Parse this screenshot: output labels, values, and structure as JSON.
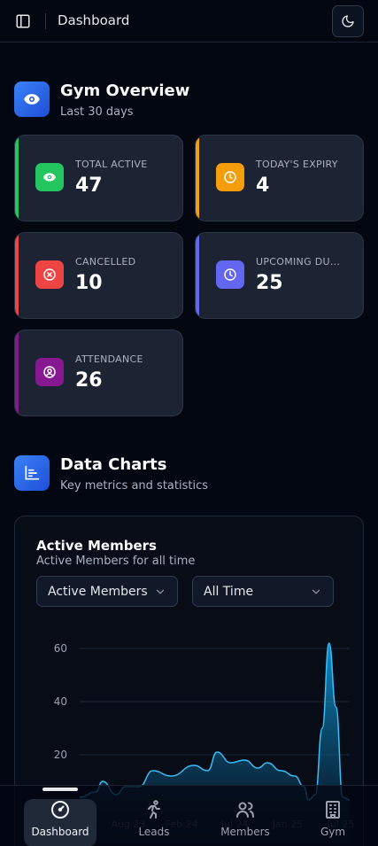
{
  "header": {
    "title": "Dashboard",
    "sidebar_toggle_icon": "panel-left-icon",
    "theme_toggle_icon": "moon-icon"
  },
  "overview": {
    "title": "Gym Overview",
    "subtitle": "Last 30 days",
    "icon": "eye-icon",
    "cards": [
      {
        "label": "TOTAL ACTIVE",
        "value": "47",
        "accent": "#22c55e",
        "icon": "eye-icon",
        "icon_bg": "#22c55e"
      },
      {
        "label": "TODAY'S EXPIRY",
        "value": "4",
        "accent": "#f59e0b",
        "icon": "clock-icon",
        "icon_bg": "#f59e0b"
      },
      {
        "label": "CANCELLED",
        "value": "10",
        "accent": "#ef4444",
        "icon": "x-circle-icon",
        "icon_bg": "#ef4444"
      },
      {
        "label": "UPCOMING DU...",
        "value": "25",
        "accent": "#6366f1",
        "icon": "clock-icon",
        "icon_bg": "#6366f1"
      },
      {
        "label": "ATTENDANCE",
        "value": "26",
        "accent": "#86198f",
        "icon": "user-circle-icon",
        "icon_bg": "#86198f"
      }
    ]
  },
  "charts_section": {
    "title": "Data Charts",
    "subtitle": "Key metrics and statistics",
    "icon": "bar-chart-icon"
  },
  "chart_panel": {
    "title": "Active Members",
    "subtitle": "Active Members for all time",
    "metric_select": "Active Members",
    "range_select": "All Time"
  },
  "chart_data": {
    "type": "area",
    "color": "#0ea5e9",
    "y_ticks": [
      20,
      40,
      60
    ],
    "ylim": [
      0,
      65
    ],
    "x_ticks": [
      "Jul 23",
      "Aug 23",
      "Feb 24",
      "Jul 24",
      "Jan 25",
      "Jul 25"
    ],
    "x": [
      0,
      0.35,
      0.5,
      0.8,
      1.0,
      1.3,
      1.6,
      2.0,
      2.5,
      2.8,
      3.0,
      3.3,
      3.6,
      3.9,
      4.1,
      4.4,
      4.7,
      4.9,
      5.0,
      5.15,
      5.3,
      5.45,
      5.6,
      5.75,
      5.9
    ],
    "y": [
      4,
      6,
      10,
      5,
      8,
      8,
      14,
      12,
      16,
      14,
      21,
      17,
      18,
      15,
      17,
      14,
      12,
      8,
      3,
      5,
      30,
      62,
      38,
      4,
      3
    ]
  },
  "bottom_nav": [
    {
      "label": "Dashboard",
      "icon": "gauge-icon",
      "active": true
    },
    {
      "label": "Leads",
      "icon": "running-person-icon",
      "active": false
    },
    {
      "label": "Members",
      "icon": "users-icon",
      "active": false
    },
    {
      "label": "Gym",
      "icon": "building-icon",
      "active": false
    }
  ]
}
